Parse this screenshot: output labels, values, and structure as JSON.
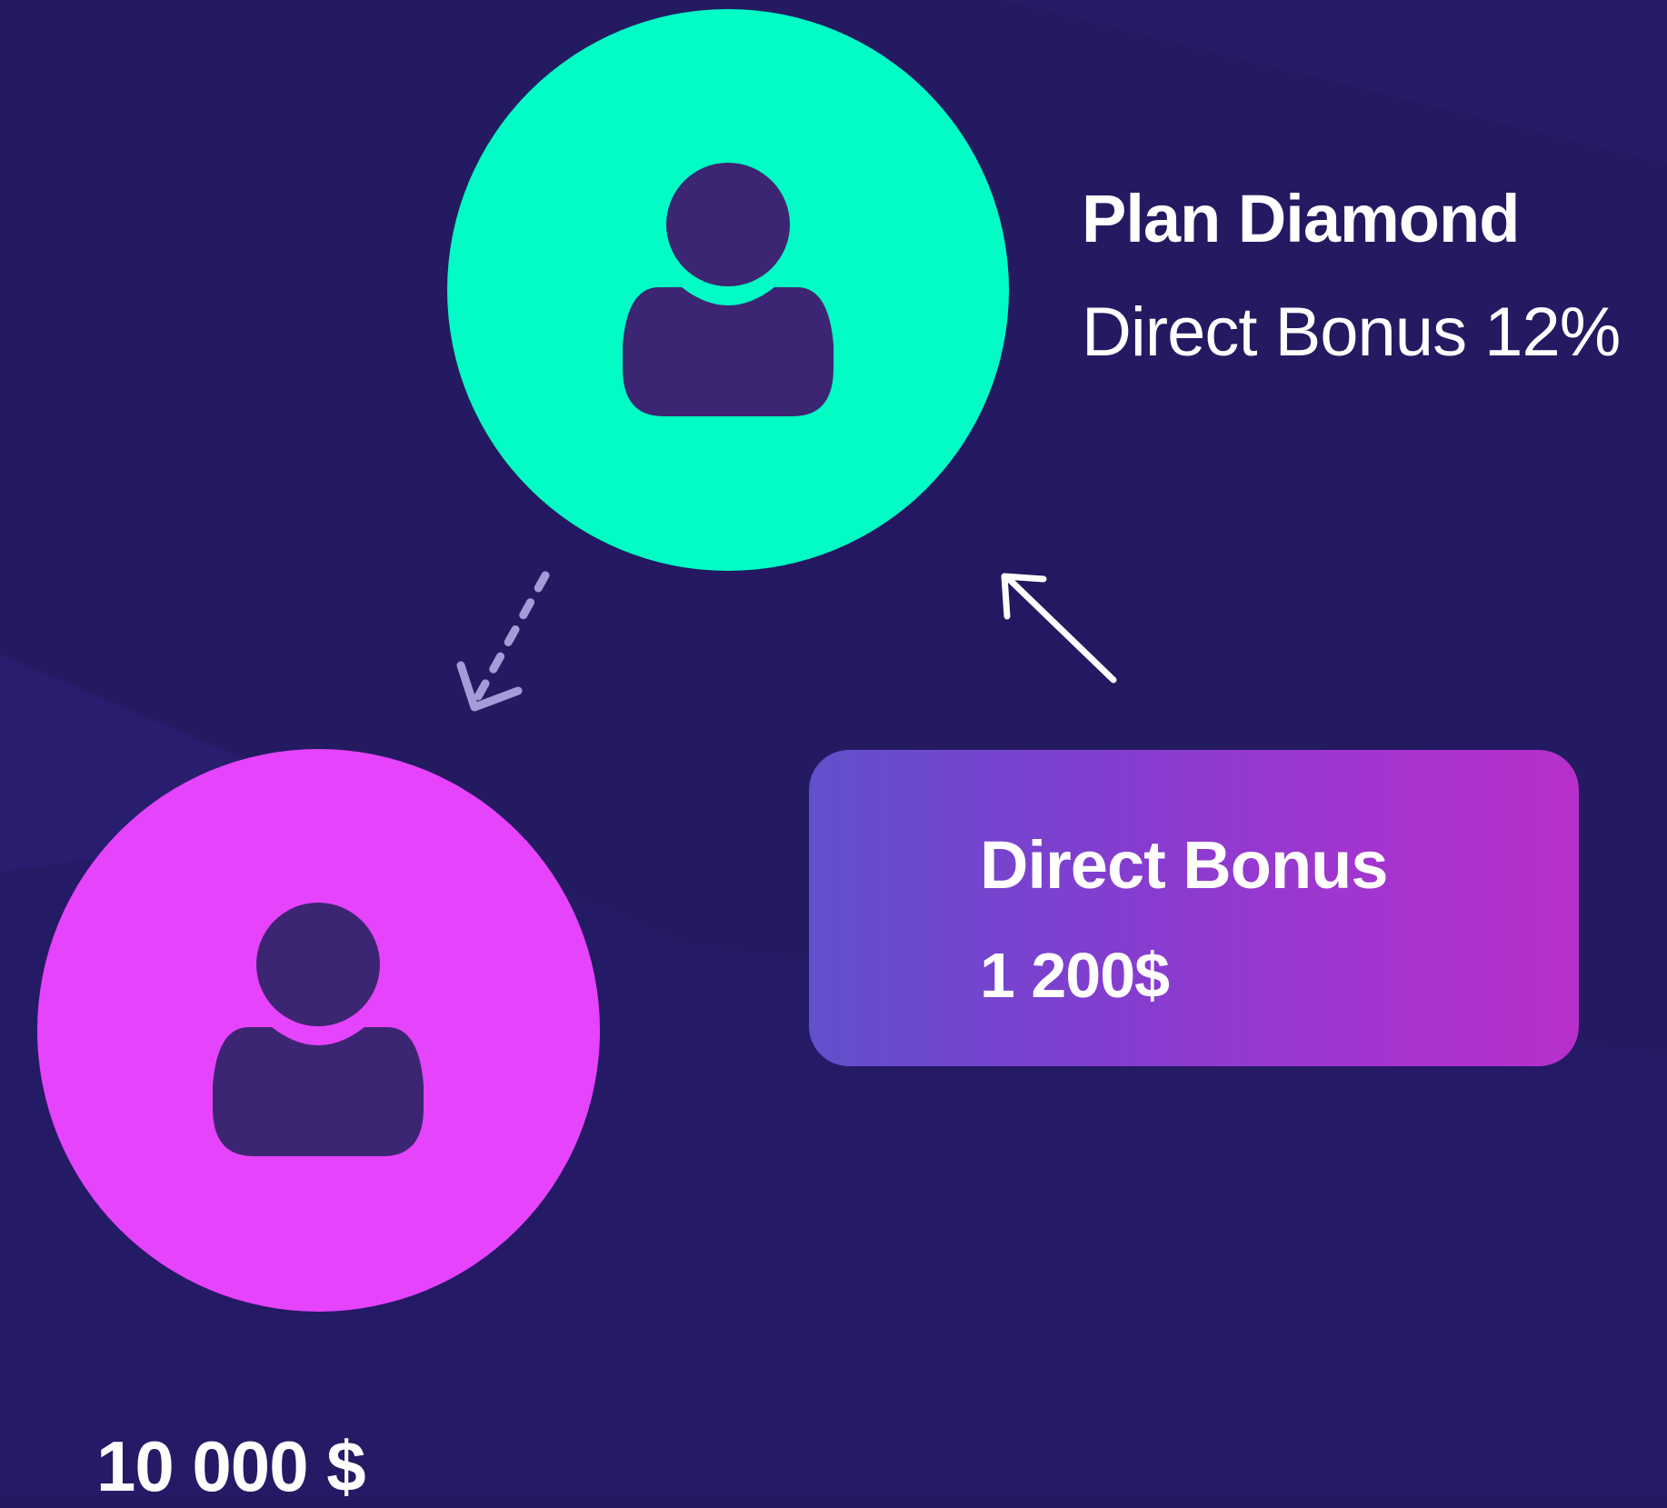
{
  "colors": {
    "background": "#241a62",
    "top_node": "#02fcc5",
    "bottom_node": "#e643fc",
    "person_icon": "#3c2572",
    "card_gradient": [
      "#6150cc",
      "#b82fcb"
    ],
    "text": "#ffffff"
  },
  "top_node": {
    "icon": "user-icon",
    "plan_title": "Plan Diamond",
    "plan_subtitle": "Direct Bonus 12%"
  },
  "bottom_node": {
    "icon": "user-icon",
    "amount": "10 000 $"
  },
  "bonus_card": {
    "label": "Direct Bonus",
    "amount": "1 200$"
  },
  "arrows": [
    {
      "name": "dashed-arrow-down-left",
      "style": "dashed"
    },
    {
      "name": "arrow-up-left",
      "style": "solid"
    }
  ]
}
